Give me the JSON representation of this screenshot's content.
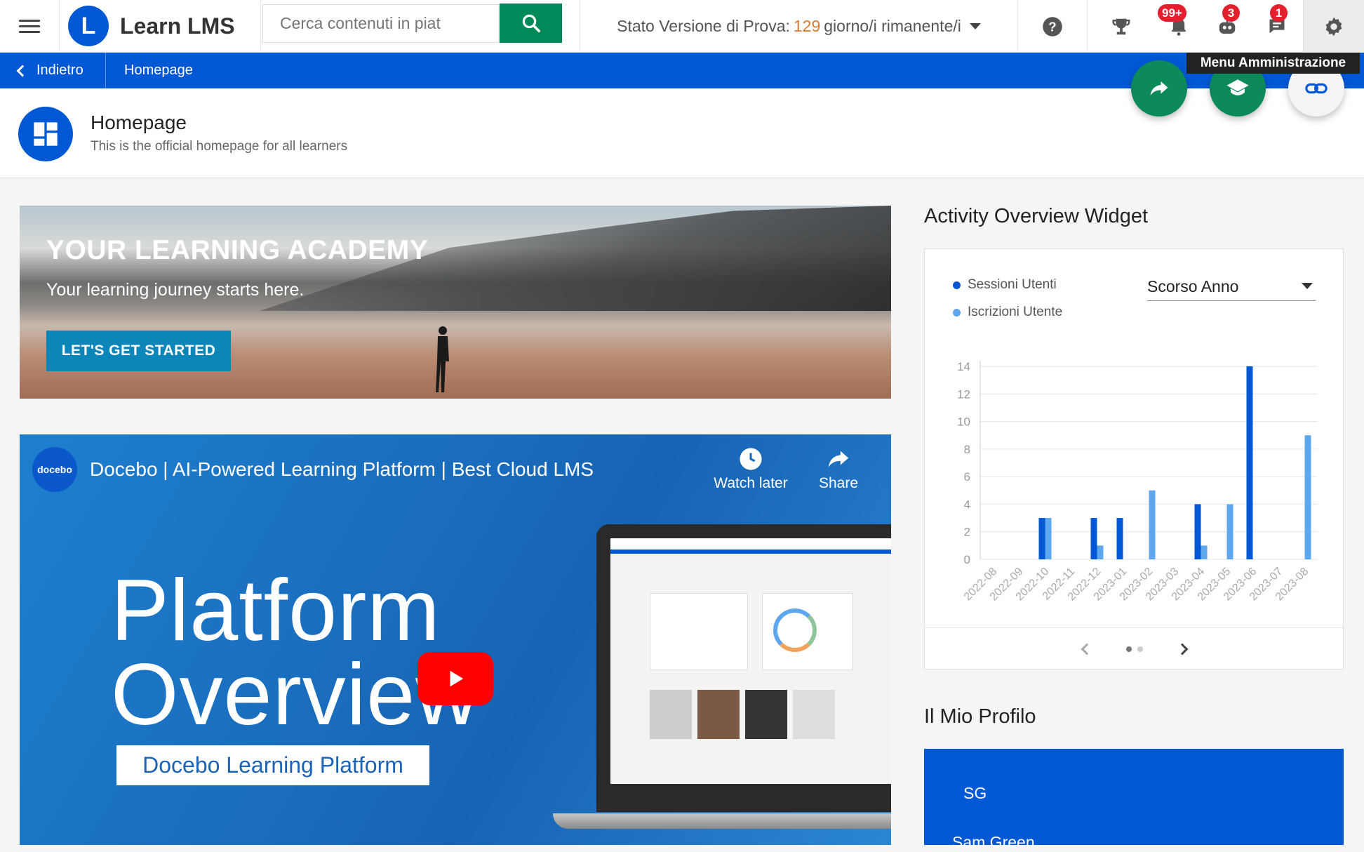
{
  "app": {
    "name": "Learn LMS",
    "logo_letter": "L"
  },
  "search": {
    "placeholder": "Cerca contenuti in piat"
  },
  "trial": {
    "label": "Stato Versione di Prova:",
    "days": "129",
    "suffix": "giorno/i rimanente/i"
  },
  "badges": {
    "notifications": "99+",
    "coach": "3",
    "messages": "1"
  },
  "tooltip": "Menu Amministrazione",
  "nav": {
    "back_label": "Indietro",
    "breadcrumb": "Homepage"
  },
  "page": {
    "title": "Homepage",
    "subtitle": "This is the official homepage for all learners"
  },
  "banner": {
    "title": "YOUR LEARNING ACADEMY",
    "subtitle": "Your learning journey starts here.",
    "cta": "LET'S GET STARTED"
  },
  "video": {
    "logo": "docebo",
    "title": "Docebo | AI-Powered Learning Platform | Best Cloud LMS",
    "watch_later": "Watch later",
    "share": "Share",
    "line1": "Platform",
    "line2": "Overview",
    "pill": "Docebo Learning Platform"
  },
  "activity": {
    "title": "Activity Overview Widget",
    "period": "Scorso Anno",
    "colors": {
      "series1": "#0058d5",
      "series2": "#5ea6ee"
    }
  },
  "chart_data": {
    "type": "bar",
    "categories": [
      "2022-08",
      "2022-09",
      "2022-10",
      "2022-11",
      "2022-12",
      "2023-01",
      "2023-02",
      "2023-03",
      "2023-04",
      "2023-05",
      "2023-06",
      "2023-07",
      "2023-08"
    ],
    "series": [
      {
        "name": "Sessioni Utenti",
        "values": [
          0,
          0,
          3,
          0,
          3,
          3,
          0,
          0,
          4,
          0,
          14,
          0,
          0
        ]
      },
      {
        "name": "Iscrizioni Utente",
        "values": [
          0,
          0,
          3,
          0,
          1,
          0,
          5,
          0,
          1,
          4,
          0,
          0,
          9
        ]
      }
    ],
    "yticks": [
      0,
      2,
      4,
      6,
      8,
      10,
      12,
      14
    ],
    "ylim": [
      0,
      14
    ],
    "grid": true,
    "legend": "top-left"
  },
  "profile": {
    "title": "Il Mio Profilo",
    "initials": "SG",
    "name": "Sam Green"
  }
}
